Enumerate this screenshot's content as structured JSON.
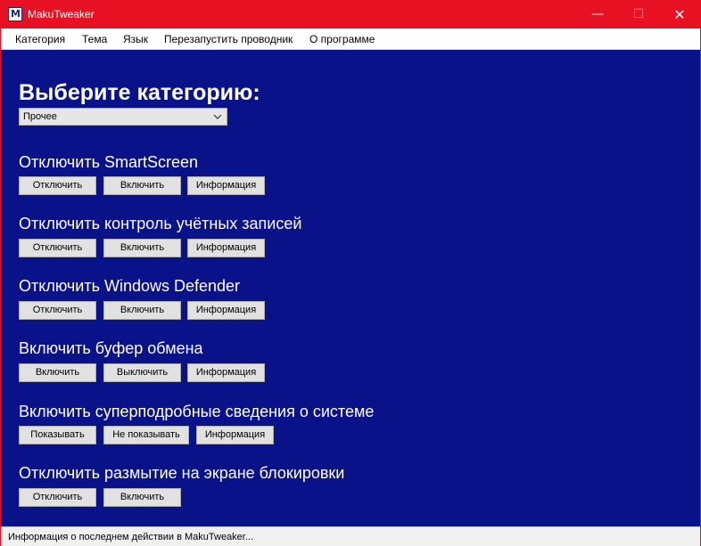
{
  "window": {
    "title": "MakuTweaker",
    "icon_letter": "M"
  },
  "controls": {
    "minimize": "—",
    "maximize": "☐",
    "close": "✕"
  },
  "menu": [
    "Категория",
    "Тема",
    "Язык",
    "Перезапустить проводник",
    "О программе"
  ],
  "heading": "Выберите категорию:",
  "category_select": {
    "value": "Прочее"
  },
  "sections": [
    {
      "title": "Отключить SmartScreen",
      "buttons": [
        "Отключить",
        "Включить",
        "Информация"
      ]
    },
    {
      "title": "Отключить контроль учётных записей",
      "buttons": [
        "Отключить",
        "Включить",
        "Информация"
      ]
    },
    {
      "title": "Отключить Windows Defender",
      "buttons": [
        "Отключить",
        "Включить",
        "Информация"
      ]
    },
    {
      "title": "Включить буфер обмена",
      "buttons": [
        "Включить",
        "Выключить",
        "Информация"
      ]
    },
    {
      "title": "Включить суперподробные сведения о системе",
      "buttons": [
        "Показывать",
        "Не показывать",
        "Информация"
      ]
    },
    {
      "title": "Отключить размытие на экране блокировки",
      "buttons": [
        "Отключить",
        "Включить"
      ]
    }
  ],
  "status": "Информация о последнем действии в MakuTweaker...",
  "colors": {
    "titlebar": "#e81123",
    "background": "#0a128a",
    "button": "#e1e1e1"
  }
}
